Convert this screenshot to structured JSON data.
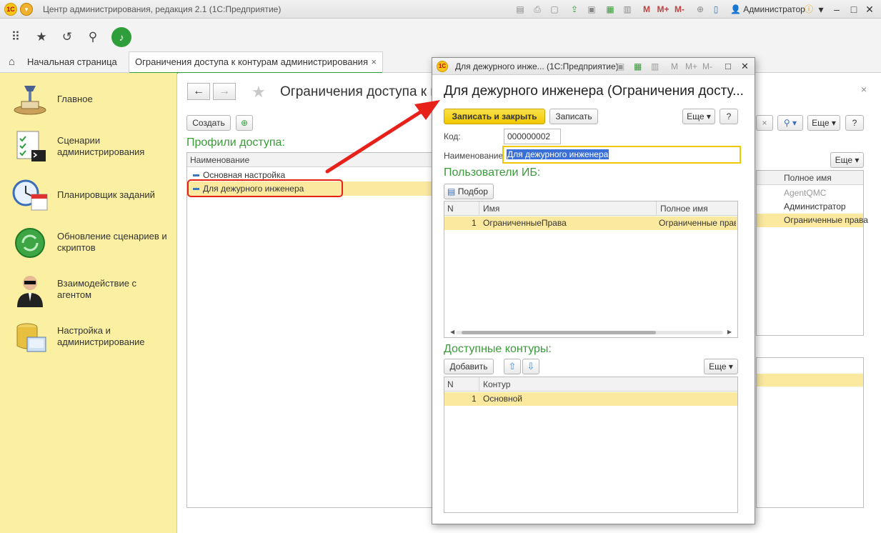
{
  "window": {
    "title": "Центр администрирования, редакция 2.1  (1С:Предприятие)",
    "user": "Администратор",
    "m_labels": [
      "M",
      "M+",
      "M-"
    ]
  },
  "toolbar": {
    "icons": [
      "apps-grid-icon",
      "favorites-star-icon",
      "history-icon",
      "search-icon",
      "notifications-bell-icon"
    ]
  },
  "tabs": {
    "home": "Начальная страница",
    "active": "Ограничения доступа к контурам администрирования",
    "close": "×"
  },
  "sidebar": {
    "items": [
      {
        "label": "Главное",
        "icon": "desk-lamp-icon"
      },
      {
        "label": "Сценарии администрирования",
        "icon": "script-checklist-icon"
      },
      {
        "label": "Планировщик заданий",
        "icon": "clock-calendar-icon"
      },
      {
        "label": "Обновление сценариев и скриптов",
        "icon": "update-arrows-icon"
      },
      {
        "label": "Взаимодействие с агентом",
        "icon": "agent-person-icon"
      },
      {
        "label": "Настройка и администрирование",
        "icon": "database-settings-icon"
      }
    ]
  },
  "background_form": {
    "title": "Ограничения доступа к к",
    "create_button": "Создать",
    "profiles_title": "Профили доступа:",
    "column_name": "Наименование",
    "rows": [
      "Основная настройка",
      "Для дежурного инженера"
    ],
    "right_more": "Еще",
    "right_column": "Полное имя",
    "right_rows": [
      "AgentQMC",
      "Администратор",
      "Ограниченные права"
    ],
    "close": "×"
  },
  "dialog": {
    "window_title": "Для дежурного инже...  (1С:Предприятие)",
    "heading": "Для дежурного инженера (Ограничения досту...",
    "save_close": "Записать и закрыть",
    "save": "Записать",
    "more": "Еще",
    "help": "?",
    "code_label": "Код:",
    "code_value": "000000002",
    "name_label": "Наименование:",
    "name_value": "Для дежурного инженера",
    "users_title": "Пользователи ИБ:",
    "pick_button": "Подбор",
    "users_columns": [
      "N",
      "Имя",
      "Полное имя"
    ],
    "users_rows": [
      {
        "n": "1",
        "name": "ОграниченныеПрава",
        "full": "Ограниченные права"
      }
    ],
    "contours_title": "Доступные контуры:",
    "add_button": "Добавить",
    "contours_columns": [
      "N",
      "Контур"
    ],
    "contours_rows": [
      {
        "n": "1",
        "contour": "Основной"
      }
    ]
  },
  "colors": {
    "accent_green": "#3a9a3a",
    "sidebar_bg": "#fbf0a2",
    "selection": "#fbe9a0",
    "primary_button": "#f5d20a",
    "annotation_red": "#e8201a"
  }
}
